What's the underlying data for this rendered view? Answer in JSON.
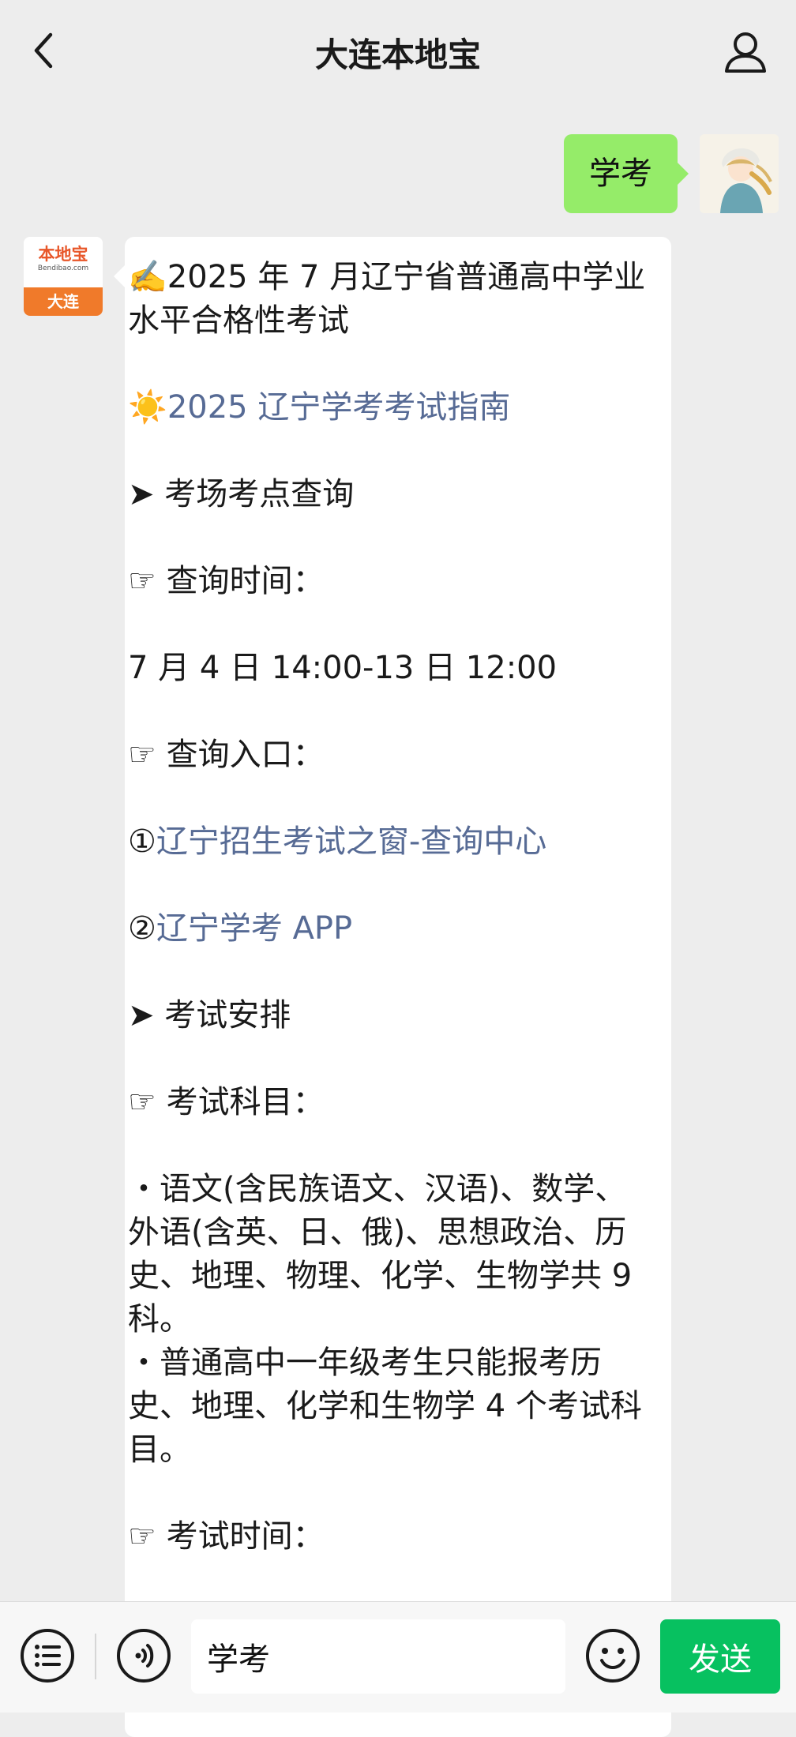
{
  "header": {
    "title": "大连本地宝",
    "back_icon": "chevron-left-icon",
    "profile_icon": "person-icon"
  },
  "user_message": {
    "text": "学考"
  },
  "bot": {
    "avatar": {
      "logo_text": "本地宝",
      "logo_subtext": "Bendibao.com",
      "city": "大连"
    },
    "lines": {
      "l1": "✍️2025 年 7 月辽宁省普通高中学业水平合格性考试",
      "l2_icon": "☀️",
      "l2_link": "2025 辽宁学考考试指南",
      "l3": "➤ 考场考点查询",
      "l4": "☞ 查询时间：",
      "l5": "7 月 4 日 14:00-13 日 12:00",
      "l6": "☞ 查询入口：",
      "l7_num": "①",
      "l7_link": "辽宁招生考试之窗-查询中心",
      "l8_num": "②",
      "l8_link": "辽宁学考 APP",
      "l9": "➤ 考试安排",
      "l10": "☞ 考试科目：",
      "l11": "・语文(含民族语文、汉语)、数学、外语(含英、日、俄)、思想政治、历史、地理、物理、化学、生物学共 9 科。",
      "l12": "・普通高中一年级考生只能报考历史、地理、化学和生物学 4 个考试科目。",
      "l13": "☞ 考试时间："
    }
  },
  "footer": {
    "input_value": "学考",
    "send_label": "发送",
    "menu_icon": "list-menu-icon",
    "voice_icon": "voice-icon",
    "emoji_icon": "emoji-icon"
  },
  "colors": {
    "background": "#ededed",
    "user_bubble": "#95ec69",
    "link": "#576b95",
    "send_button": "#07c160",
    "brand_orange": "#f07a2a"
  }
}
